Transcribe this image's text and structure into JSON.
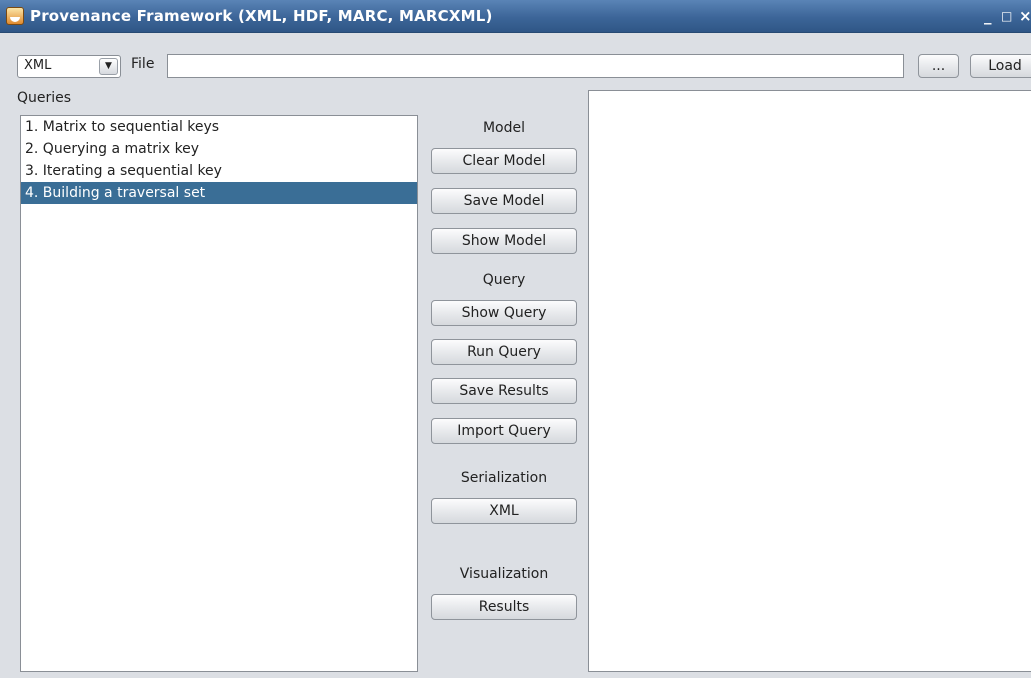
{
  "window": {
    "title": "Provenance Framework (XML, HDF, MARC, MARCXML)",
    "minimize_glyph": "_",
    "maximize_glyph": "□",
    "close_glyph": "×"
  },
  "toolbar": {
    "format_selected": "XML",
    "file_label": "File",
    "file_value": "",
    "browse_label": "...",
    "load_label": "Load"
  },
  "queries": {
    "label": "Queries",
    "items": [
      "1. Matrix to sequential keys",
      "2. Querying a matrix key",
      "3. Iterating a sequential key",
      "4. Building a traversal set"
    ],
    "selected_index": 3
  },
  "sidebar": {
    "model_label": "Model",
    "clear_model": "Clear Model",
    "save_model": "Save Model",
    "show_model": "Show Model",
    "query_label": "Query",
    "show_query": "Show Query",
    "run_query": "Run Query",
    "save_results": "Save Results",
    "import_query": "Import Query",
    "serialization_label": "Serialization",
    "xml_button": "XML",
    "visualization_label": "Visualization",
    "results_button": "Results"
  },
  "colors": {
    "titlebar": "#3c6598",
    "selection": "#3a6e96",
    "window_bg": "#dcdfe4"
  }
}
